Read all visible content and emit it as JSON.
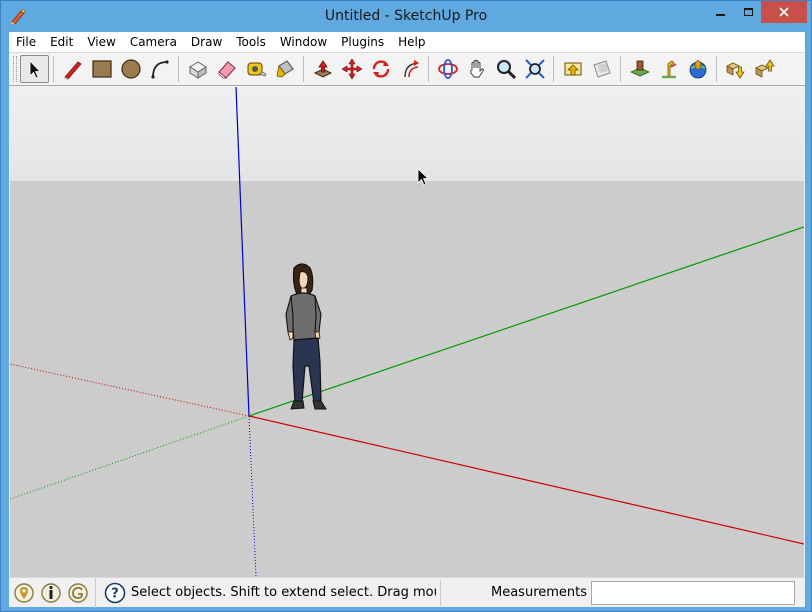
{
  "window": {
    "title": "Untitled - SketchUp Pro",
    "app_icon": "sketchup-pencil-icon"
  },
  "menu": {
    "items": [
      {
        "label": "File"
      },
      {
        "label": "Edit"
      },
      {
        "label": "View"
      },
      {
        "label": "Camera"
      },
      {
        "label": "Draw"
      },
      {
        "label": "Tools"
      },
      {
        "label": "Window"
      },
      {
        "label": "Plugins"
      },
      {
        "label": "Help"
      }
    ]
  },
  "toolbar": {
    "tools": [
      {
        "icon": "select-arrow-icon",
        "active": true
      },
      {
        "icon": "pencil-line-icon"
      },
      {
        "icon": "rectangle-icon"
      },
      {
        "icon": "circle-icon"
      },
      {
        "icon": "arc-icon"
      },
      {
        "icon": "make-component-icon"
      },
      {
        "icon": "eraser-icon"
      },
      {
        "icon": "tape-measure-icon"
      },
      {
        "icon": "paint-bucket-icon"
      },
      {
        "icon": "push-pull-icon"
      },
      {
        "icon": "move-icon"
      },
      {
        "icon": "rotate-icon"
      },
      {
        "icon": "offset-icon"
      },
      {
        "icon": "orbit-icon"
      },
      {
        "icon": "pan-hand-icon"
      },
      {
        "icon": "zoom-icon"
      },
      {
        "icon": "zoom-extents-icon"
      },
      {
        "icon": "previous-view-icon"
      },
      {
        "icon": "next-view-icon"
      },
      {
        "icon": "add-location-icon"
      },
      {
        "icon": "toggle-terrain-icon"
      },
      {
        "icon": "photo-textures-icon"
      },
      {
        "icon": "share-model-icon"
      },
      {
        "icon": "get-models-icon"
      },
      {
        "icon": "share-component-icon"
      }
    ]
  },
  "colors": {
    "title_bar": "#5fa9e0",
    "close_button": "#c7504a",
    "axis_red": "#cc0000",
    "axis_green": "#009900",
    "axis_blue": "#0000cc",
    "sky": "#e6e8ea",
    "ground": "#cccccc"
  },
  "status": {
    "icons": [
      "geo-location-icon",
      "credits-icon",
      "user-signin-icon"
    ],
    "help_icon": "help-question-icon",
    "message": "Select objects. Shift to extend select. Drag mouse tc",
    "measurements_label": "Measurements",
    "measurements_value": ""
  }
}
